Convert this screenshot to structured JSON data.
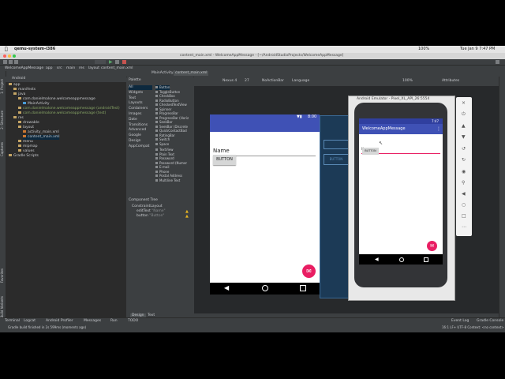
{
  "mac_menubar": {
    "app": "qemu-system-i386",
    "battery": "100%",
    "clock": "Tue Jan 9  7:47 PM"
  },
  "window": {
    "title": "content_main.xml - WelcomeAppMessage - [~/AndroidStudioProjects/WelcomeAppMessage]"
  },
  "toolbar": {
    "project_crumbs": [
      "WelcomeAppMessage",
      "app",
      "src",
      "main",
      "res",
      "layout",
      "content_main.xml"
    ]
  },
  "tabs": {
    "tab1": "MainActivity.kt",
    "tab2": "content_main.xml"
  },
  "project_panel": {
    "header": "Android",
    "items": [
      {
        "label": "app",
        "indent": 0,
        "type": "module"
      },
      {
        "label": "manifests",
        "indent": 1,
        "type": "folder"
      },
      {
        "label": "java",
        "indent": 1,
        "type": "folder"
      },
      {
        "label": "com.danielmalone.welcomeappmessage",
        "indent": 2,
        "type": "folder"
      },
      {
        "label": "MainActivity",
        "indent": 3,
        "type": "class"
      },
      {
        "label": "com.danielmalone.welcomeappmessage (androidTest)",
        "indent": 2,
        "type": "folder"
      },
      {
        "label": "com.danielmalone.welcomeappmessage (test)",
        "indent": 2,
        "type": "folder"
      },
      {
        "label": "res",
        "indent": 1,
        "type": "folder"
      },
      {
        "label": "drawable",
        "indent": 2,
        "type": "folder"
      },
      {
        "label": "layout",
        "indent": 2,
        "type": "folder"
      },
      {
        "label": "activity_main.xml",
        "indent": 3,
        "type": "file"
      },
      {
        "label": "content_main.xml",
        "indent": 3,
        "type": "file"
      },
      {
        "label": "menu",
        "indent": 2,
        "type": "folder"
      },
      {
        "label": "mipmap",
        "indent": 2,
        "type": "folder"
      },
      {
        "label": "values",
        "indent": 2,
        "type": "folder"
      },
      {
        "label": "Gradle Scripts",
        "indent": 0,
        "type": "folder"
      }
    ]
  },
  "palette": {
    "title": "Palette",
    "categories": [
      "All",
      "Widgets",
      "Text",
      "Layouts",
      "Containers",
      "Images",
      "Date",
      "Transitions",
      "Advanced",
      "Google",
      "Design",
      "AppCompat"
    ],
    "widgets": [
      "Button",
      "ToggleButton",
      "CheckBox",
      "RadioButton",
      "CheckedTextView",
      "Spinner",
      "ProgressBar",
      "ProgressBar (Horiz",
      "SeekBar",
      "SeekBar (Discrete",
      "QuickContactBad",
      "RatingBar",
      "Switch",
      "Space"
    ],
    "text_widgets": [
      "TextView",
      "Plain Text",
      "Password",
      "Password (Numer",
      "E-mail",
      "Phone",
      "Postal Address",
      "Multiline Text"
    ]
  },
  "component_tree": {
    "title": "Component Tree",
    "root": "ConstraintLayout",
    "children": [
      {
        "id": "editText",
        "desc": "\"Name\""
      },
      {
        "id": "button",
        "desc": "\"Button\""
      }
    ]
  },
  "design_toolbar": {
    "device": "Nexus 4",
    "api": "27",
    "theme": "NoActionBar",
    "language": "Language",
    "zoom": "100%",
    "attributes": "Attributes"
  },
  "phone_preview": {
    "time": "8:00",
    "edit_hint": "Name",
    "button_label": "BUTTON"
  },
  "emulator": {
    "title": "Android Emulator - Pixel_XL_API_26:5554",
    "status_time": "7:47",
    "app_title": "WelcomeAppMessage",
    "edit_hint": "Name",
    "button_label": "BUTTON"
  },
  "bottom_tabs": {
    "design": "Design",
    "text": "Text"
  },
  "tool_windows": [
    "Terminal",
    "Logcat",
    "Android Profiler",
    "Messages",
    "Run",
    "TODO"
  ],
  "tool_windows_right": [
    "Event Log",
    "Gradle Console"
  ],
  "status_bar": {
    "message": "Gradle build finished in 2s 599ms (moments ago)",
    "right": "16:1  LF+  UTF-8  Context: <no context>"
  },
  "colors": {
    "accent": "#3f51b5",
    "fab": "#e91e63",
    "ide_bg": "#3c3f41",
    "editor_bg": "#2b2b2b"
  }
}
